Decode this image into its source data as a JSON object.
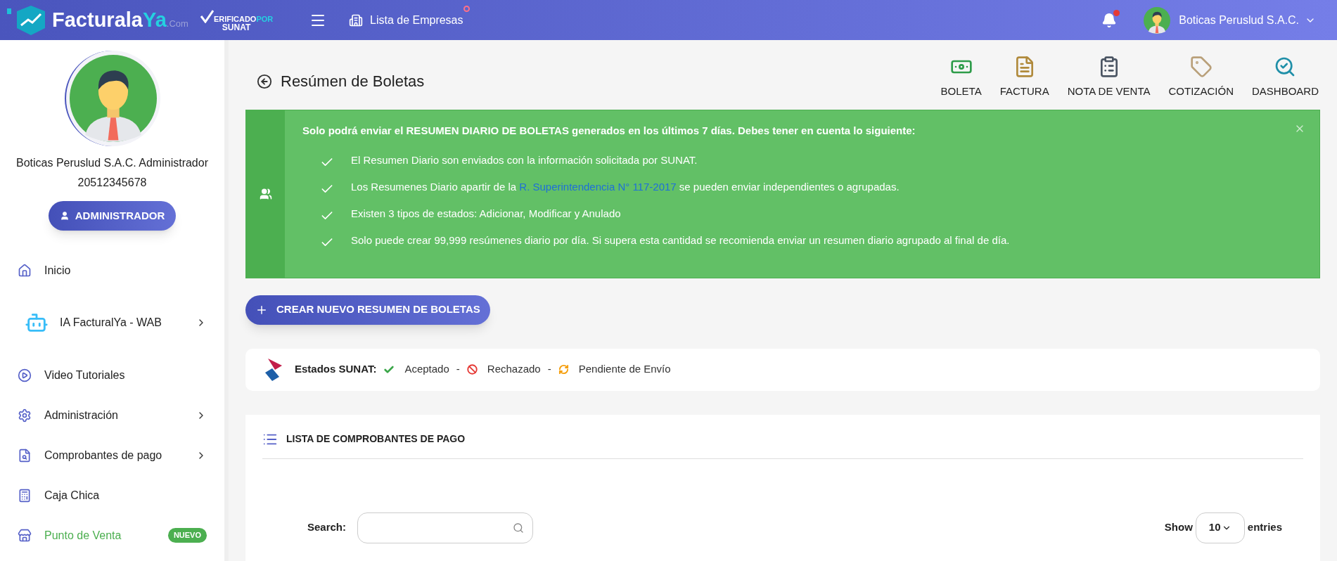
{
  "topbar": {
    "logo": {
      "part_1": "Facturala",
      "part_2": "Ya",
      "part_3": ".Com"
    },
    "verified": {
      "line_1": "ERIFICADO",
      "line_1_accent": "POR",
      "line_2": "SUNAT"
    },
    "companies_link": "Lista de Empresas",
    "companies_dot": true,
    "notification_dot": true,
    "user_name": "Boticas Peruslud S.A.C."
  },
  "sidebar": {
    "profile_name": "Boticas Peruslud S.A.C. Administrador",
    "profile_id": "20512345678",
    "role_button": "ADMINISTRADOR",
    "items": [
      {
        "kind": "home",
        "label": "Inicio",
        "has_arrow": false,
        "highlighted": false
      },
      {
        "kind": "robot",
        "label": "IA FacturalYa - WAB",
        "has_arrow": true,
        "highlighted": false
      },
      {
        "kind": "video",
        "label": "Video Tutoriales",
        "has_arrow": false,
        "highlighted": false
      },
      {
        "kind": "gear",
        "label": "Administración",
        "has_arrow": true,
        "highlighted": false
      },
      {
        "kind": "document",
        "label": "Comprobantes de pago",
        "has_arrow": true,
        "highlighted": false
      },
      {
        "kind": "calculator",
        "label": "Caja Chica",
        "has_arrow": false,
        "highlighted": false
      },
      {
        "kind": "store",
        "label": "Punto de Venta",
        "has_arrow": false,
        "highlighted": true,
        "badge": "NUEVO"
      }
    ]
  },
  "page": {
    "title": "Resúmen de Boletas",
    "shortcuts": [
      {
        "kind": "boleta",
        "label": "BOLETA"
      },
      {
        "kind": "factura",
        "label": "FACTURA"
      },
      {
        "kind": "nota",
        "label": "NOTA DE VENTA"
      },
      {
        "kind": "cotizacion",
        "label": "COTIZACIÓN"
      },
      {
        "kind": "dashboard",
        "label": "DASHBOARD"
      }
    ],
    "alert": {
      "heading": "Solo podrá enviar el RESUMEN DIARIO DE BOLETAS generados en los últimos 7 días. Debes tener en cuenta lo siguiente:",
      "items": [
        {
          "kind": "text",
          "text": "El Resumen Diario son enviados con la información solicitada por SUNAT."
        },
        {
          "kind": "link",
          "before": "Los Resumenes Diario apartir de la",
          "link": "R. Superintendencia N° 117-2017",
          "after": "se pueden enviar independientes o agrupadas."
        },
        {
          "kind": "text",
          "text": "Existen 3 tipos de estados: Adicionar, Modificar y Anulado"
        },
        {
          "kind": "text",
          "text": "Solo puede crear 99,999 resúmenes diario por día. Si supera esta cantidad se recomienda enviar un resumen diario agrupado al final de día."
        }
      ]
    },
    "create_button": "CREAR NUEVO RESUMEN DE BOLETAS",
    "states": {
      "label": "Estados SUNAT:",
      "items": [
        {
          "kind": "accepted",
          "label": "Aceptado"
        },
        {
          "kind": "rejected",
          "label": "Rechazado",
          "separator": "-"
        },
        {
          "kind": "pending",
          "label": "Pendiente de Envío",
          "separator": "-"
        }
      ]
    },
    "list": {
      "title": "LISTA DE COMPROBANTES DE PAGO",
      "search_label": "Search:",
      "show_label": "Show",
      "show_value": "10",
      "entries_label": "entries"
    }
  }
}
